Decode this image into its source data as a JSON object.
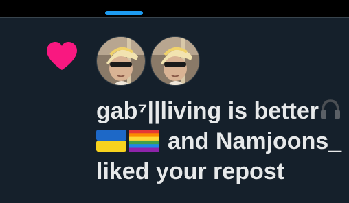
{
  "colors": {
    "background": "#15202b",
    "topbar": "#000000",
    "tab_indicator": "#1d9bf0",
    "heart": "#f91880",
    "text": "#e7e9ea"
  },
  "notification": {
    "icon": "heart-icon",
    "line1_name": "gab⁷||living is better",
    "line1_emoji": "headphones-icon",
    "line2_flags": [
      "ukraine-flag-icon",
      "rainbow-flag-icon"
    ],
    "line2_text": "and Namjoons_",
    "line3_text": "liked your repost"
  }
}
